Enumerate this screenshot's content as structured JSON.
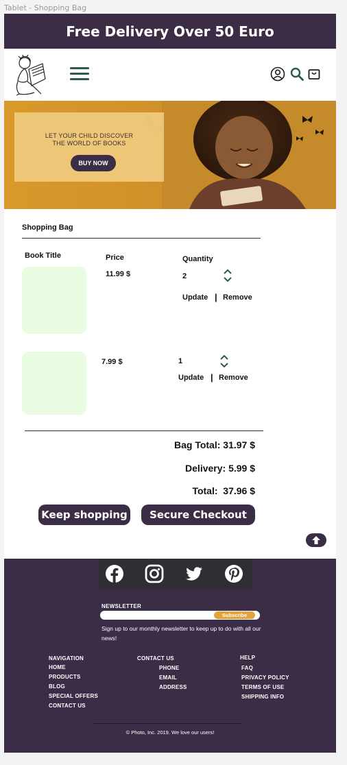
{
  "frame_label": "Tablet - Shopping Bag",
  "promo": {
    "text": "Free Delivery Over 50 Euro"
  },
  "header": {
    "icons": [
      "menu-icon",
      "user-icon",
      "search-icon",
      "shopping-bag-icon"
    ]
  },
  "hero": {
    "text": "LET YOUR CHILD DISCOVER THE WORLD OF BOOKS",
    "button": "BUY NOW"
  },
  "bag": {
    "title": "Shopping Bag",
    "columns": {
      "title": "Book Title",
      "price": "Price",
      "quantity": "Quantity"
    },
    "items": [
      {
        "price": "11.99 $",
        "quantity": "2",
        "update": "Update",
        "separator": "|",
        "remove": "Remove"
      },
      {
        "price": "7.99 $",
        "quantity": "1",
        "update": "Update",
        "separator": "|",
        "remove": "Remove"
      }
    ],
    "bag_total": "Bag Total: 31.97 $",
    "delivery": "Delivery: 5.99 $",
    "total": "Total:  37.96 $"
  },
  "actions": {
    "keep_shopping": "Keep shopping",
    "checkout": "Secure Checkout"
  },
  "footer": {
    "social": [
      "facebook-icon",
      "instagram-icon",
      "twitter-icon",
      "pinterest-icon"
    ],
    "newsletter": {
      "title": "NEWSLETTER",
      "button": "Subscribe",
      "description": "Sign up to our monthly newsletter to keep up to do with all our news!"
    },
    "navigation": {
      "title": "NAVIGATION",
      "items": [
        "HOME",
        "PRODUCTS",
        "BLOG",
        "SPECIAL OFFERS",
        "CONTACT US"
      ]
    },
    "contact": {
      "title": "CONTACT US",
      "items": [
        "PHONE",
        "EMAIL",
        "ADDRESS"
      ]
    },
    "help": {
      "title": "HELP",
      "items": [
        "FAQ",
        "PRIVACY POLICY",
        "TERMS OF USE",
        "SHIPPING INFO"
      ]
    },
    "copyright": "© Photo, Inc. 2019. We love our users!"
  },
  "colors": {
    "brand": "#3b2d45",
    "accent": "#e2a23c",
    "icon_green": "#2c5a4e",
    "thumb_bg": "#e9fbe0"
  }
}
